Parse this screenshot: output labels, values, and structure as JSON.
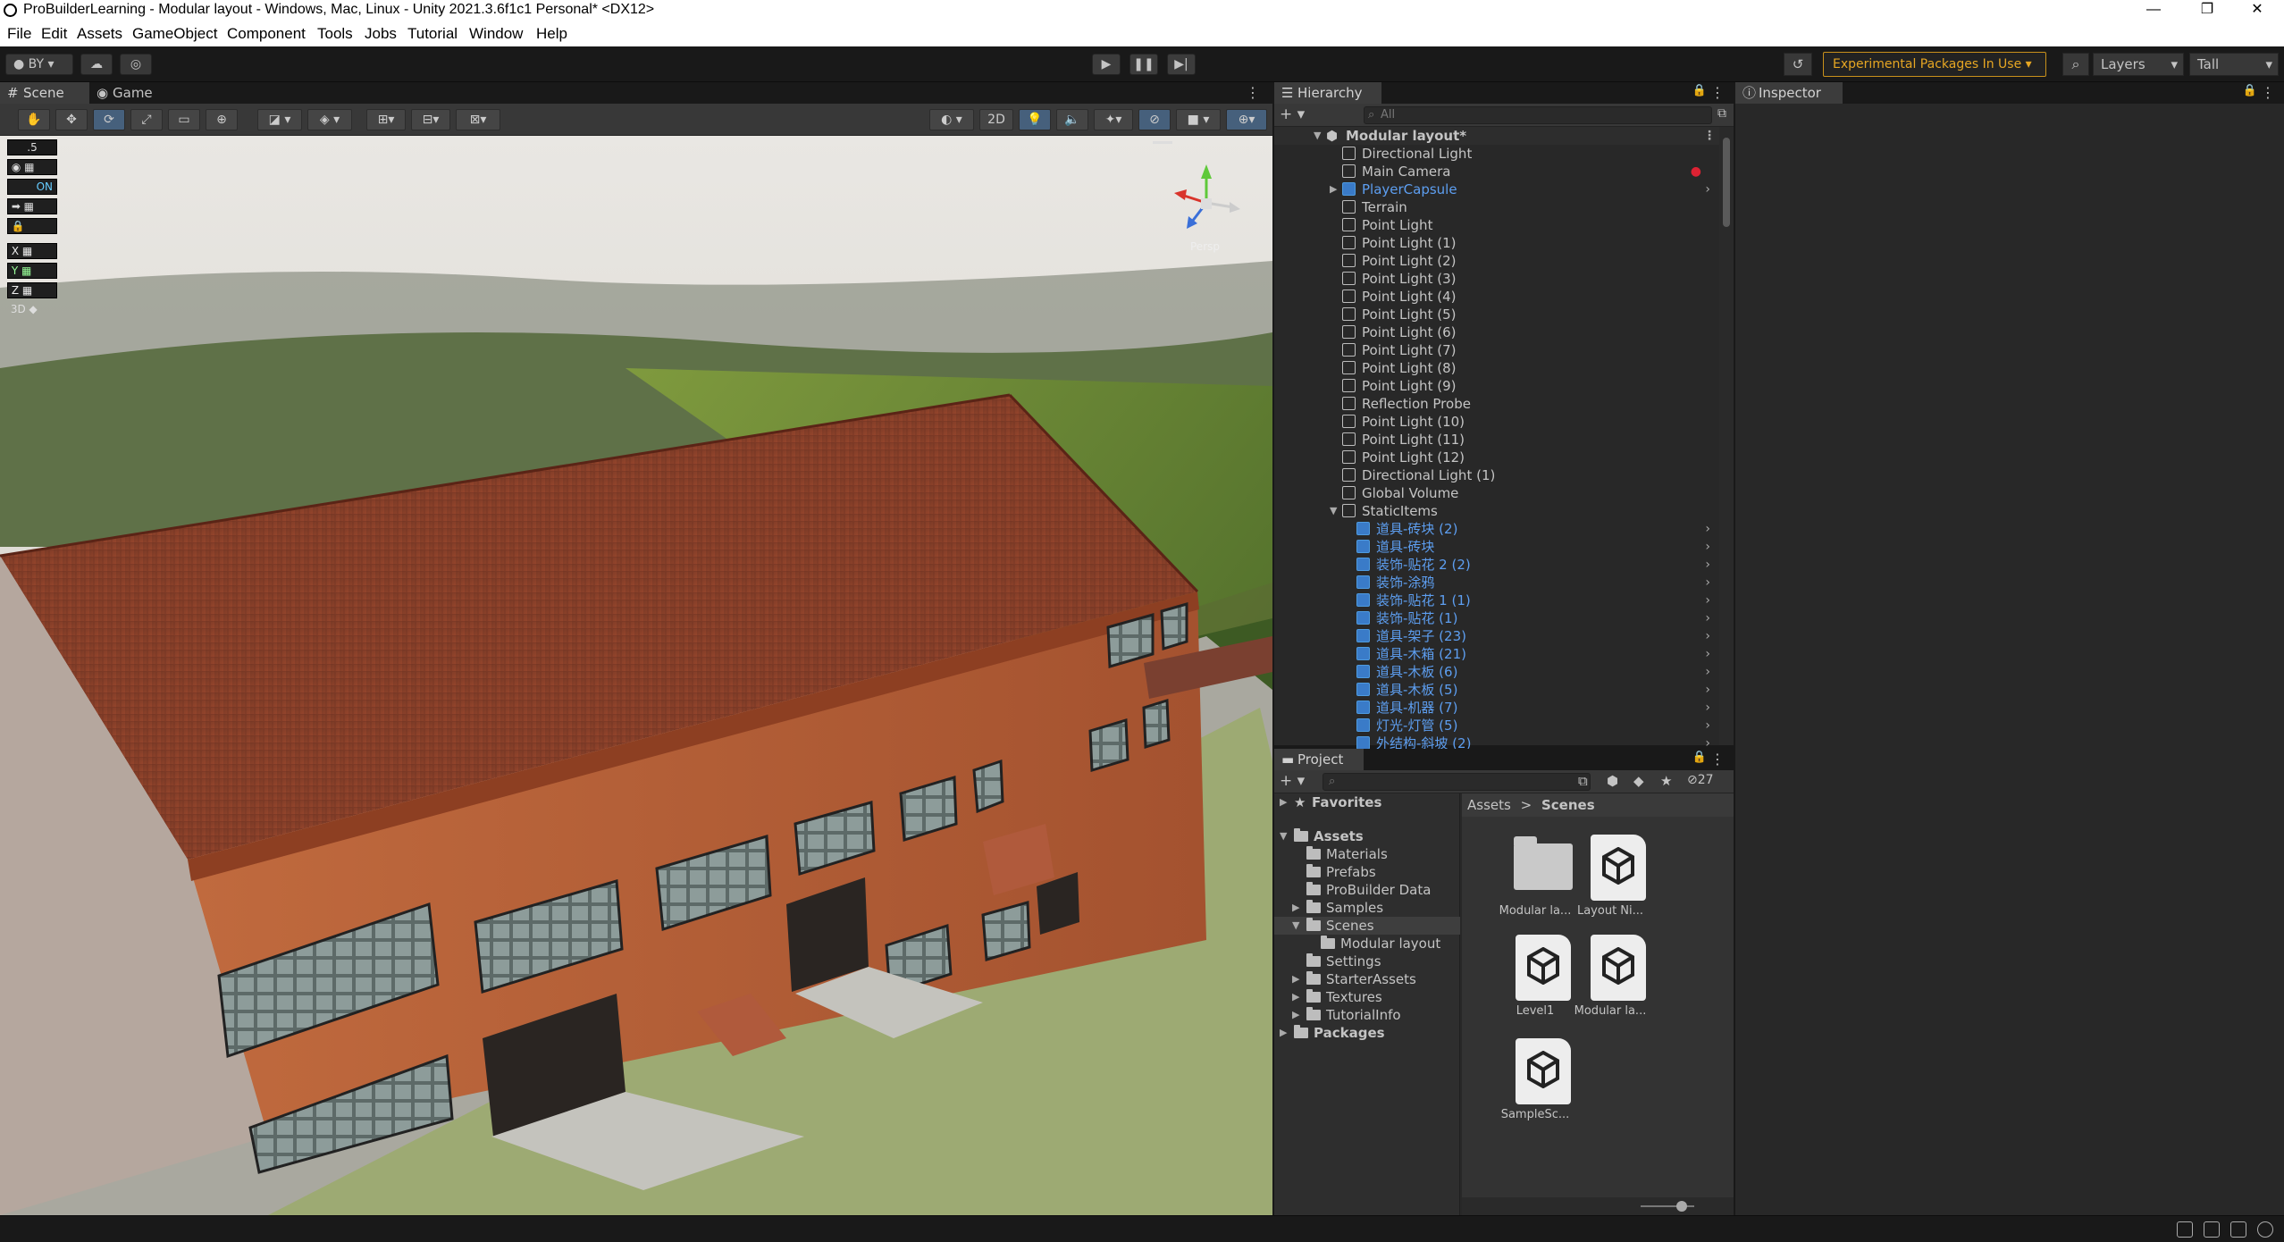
{
  "window": {
    "title": "ProBuilderLearning - Modular layout - Windows, Mac, Linux - Unity 2021.3.6f1c1 Personal* <DX12>"
  },
  "menu": [
    "File",
    "Edit",
    "Assets",
    "GameObject",
    "Component",
    "Tools",
    "Jobs",
    "Tutorial",
    "Window",
    "Help"
  ],
  "toolbar": {
    "account": "BY",
    "experimental": "Experimental Packages In Use",
    "layers": "Layers",
    "layout": "Tall"
  },
  "scene_tabs": {
    "scene": "Scene",
    "game": "Game"
  },
  "scene_tools": {
    "two_d": "2D"
  },
  "overlay": {
    "snap": ".5",
    "on_label": "ON",
    "x": "X",
    "y": "Y",
    "z": "Z",
    "three_d": "3D",
    "persp": "Persp"
  },
  "hierarchy": {
    "tab": "Hierarchy",
    "search_placeholder": "All",
    "root": "Modular layout*",
    "items": [
      {
        "label": "Directional Light",
        "blue": false
      },
      {
        "label": "Main Camera",
        "blue": false
      },
      {
        "label": "PlayerCapsule",
        "blue": true
      },
      {
        "label": "Terrain",
        "blue": false
      },
      {
        "label": "Point Light",
        "blue": false
      },
      {
        "label": "Point Light (1)",
        "blue": false
      },
      {
        "label": "Point Light (2)",
        "blue": false
      },
      {
        "label": "Point Light (3)",
        "blue": false
      },
      {
        "label": "Point Light (4)",
        "blue": false
      },
      {
        "label": "Point Light (5)",
        "blue": false
      },
      {
        "label": "Point Light (6)",
        "blue": false
      },
      {
        "label": "Point Light (7)",
        "blue": false
      },
      {
        "label": "Point Light (8)",
        "blue": false
      },
      {
        "label": "Point Light (9)",
        "blue": false
      },
      {
        "label": "Reflection Probe",
        "blue": false
      },
      {
        "label": "Point Light (10)",
        "blue": false
      },
      {
        "label": "Point Light (11)",
        "blue": false
      },
      {
        "label": "Point Light (12)",
        "blue": false
      },
      {
        "label": "Directional Light (1)",
        "blue": false
      },
      {
        "label": "Global Volume",
        "blue": false
      },
      {
        "label": "StaticItems",
        "blue": false
      },
      {
        "label": "道具-砖块 (2)",
        "blue": true
      },
      {
        "label": "道具-砖块",
        "blue": true
      },
      {
        "label": "装饰-贴花 2 (2)",
        "blue": true
      },
      {
        "label": "装饰-涂鸦",
        "blue": true
      },
      {
        "label": "装饰-贴花 1 (1)",
        "blue": true
      },
      {
        "label": "装饰-贴花 (1)",
        "blue": true
      },
      {
        "label": "道具-架子 (23)",
        "blue": true
      },
      {
        "label": "道具-木箱 (21)",
        "blue": true
      },
      {
        "label": "道具-木板 (6)",
        "blue": true
      },
      {
        "label": "道具-木板 (5)",
        "blue": true
      },
      {
        "label": "道具-机器 (7)",
        "blue": true
      },
      {
        "label": "灯光-灯管 (5)",
        "blue": true
      },
      {
        "label": "外结构-斜坡 (2)",
        "blue": true
      }
    ]
  },
  "project": {
    "tab": "Project",
    "hidden_count": "27",
    "favorites": "Favorites",
    "tree": [
      {
        "label": "Assets",
        "bold": true
      },
      {
        "label": "Materials"
      },
      {
        "label": "Prefabs"
      },
      {
        "label": "ProBuilder Data"
      },
      {
        "label": "Samples"
      },
      {
        "label": "Scenes"
      },
      {
        "label": "Modular layout"
      },
      {
        "label": "Settings"
      },
      {
        "label": "StarterAssets"
      },
      {
        "label": "Textures"
      },
      {
        "label": "TutorialInfo"
      },
      {
        "label": "Packages",
        "bold": true
      }
    ],
    "breadcrumb": {
      "root": "Assets",
      "sep": ">",
      "current": "Scenes"
    },
    "assets": [
      {
        "label": "Modular la...",
        "kind": "folder"
      },
      {
        "label": "Layout Ni...",
        "kind": "scene"
      },
      {
        "label": "Level1",
        "kind": "scene"
      },
      {
        "label": "Modular la...",
        "kind": "scene"
      },
      {
        "label": "SampleSc...",
        "kind": "scene"
      }
    ]
  },
  "inspector": {
    "tab": "Inspector"
  },
  "colors": {
    "accent": "#e6a623",
    "prefab_blue": "#5d9ef0",
    "panel": "#282828"
  }
}
